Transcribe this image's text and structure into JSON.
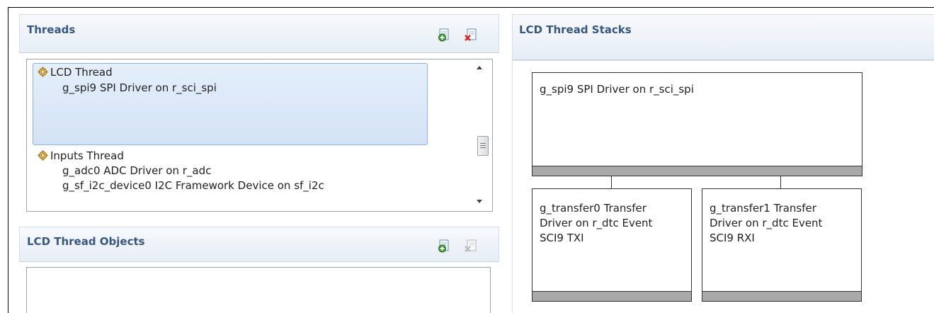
{
  "threads_panel": {
    "title": "Threads",
    "add_icon": "add-thread-icon",
    "remove_icon": "remove-thread-icon",
    "threads": [
      {
        "name": "LCD Thread",
        "items": [
          "g_spi9 SPI Driver on r_sci_spi"
        ],
        "selected": true
      },
      {
        "name": "Inputs Thread",
        "items": [
          "g_adc0 ADC Driver on r_adc",
          "g_sf_i2c_device0 I2C Framework Device on sf_i2c"
        ],
        "selected": false
      }
    ]
  },
  "objects_panel": {
    "title": "LCD Thread Objects",
    "add_icon": "add-object-icon",
    "remove_icon": "remove-object-icon"
  },
  "stacks_panel": {
    "title": "LCD Thread Stacks",
    "top_module": "g_spi9 SPI Driver on r_sci_spi",
    "child_modules": [
      "g_transfer0 Transfer\nDriver on r_dtc Event\nSCI9 TXI",
      "g_transfer1 Transfer\nDriver on r_dtc Event\nSCI9 RXI"
    ]
  },
  "colors": {
    "header_title": "#37577f",
    "selection_fill": "#d3e2f5",
    "selection_border": "#8eb3dd",
    "stack_bar": "#a9a9a9"
  }
}
